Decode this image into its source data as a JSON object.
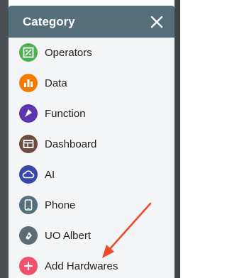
{
  "panel": {
    "title": "Category"
  },
  "items": [
    {
      "label": "Operators",
      "color": "#4caf50",
      "icon": "operators-icon"
    },
    {
      "label": "Data",
      "color": "#f57c00",
      "icon": "data-bar-chart-icon"
    },
    {
      "label": "Function",
      "color": "#5e35b1",
      "icon": "function-icon"
    },
    {
      "label": "Dashboard",
      "color": "#6d4c41",
      "icon": "dashboard-icon"
    },
    {
      "label": "AI",
      "color": "#3949ab",
      "icon": "ai-cloud-icon"
    },
    {
      "label": "Phone",
      "color": "#546e7a",
      "icon": "phone-icon"
    },
    {
      "label": "UO Albert",
      "color": "#5f6b73",
      "icon": "robot-icon"
    },
    {
      "label": "Add Hardwares",
      "color": "#f0506e",
      "icon": "plus-icon"
    }
  ],
  "annotation": {
    "color": "#f04a2a"
  }
}
